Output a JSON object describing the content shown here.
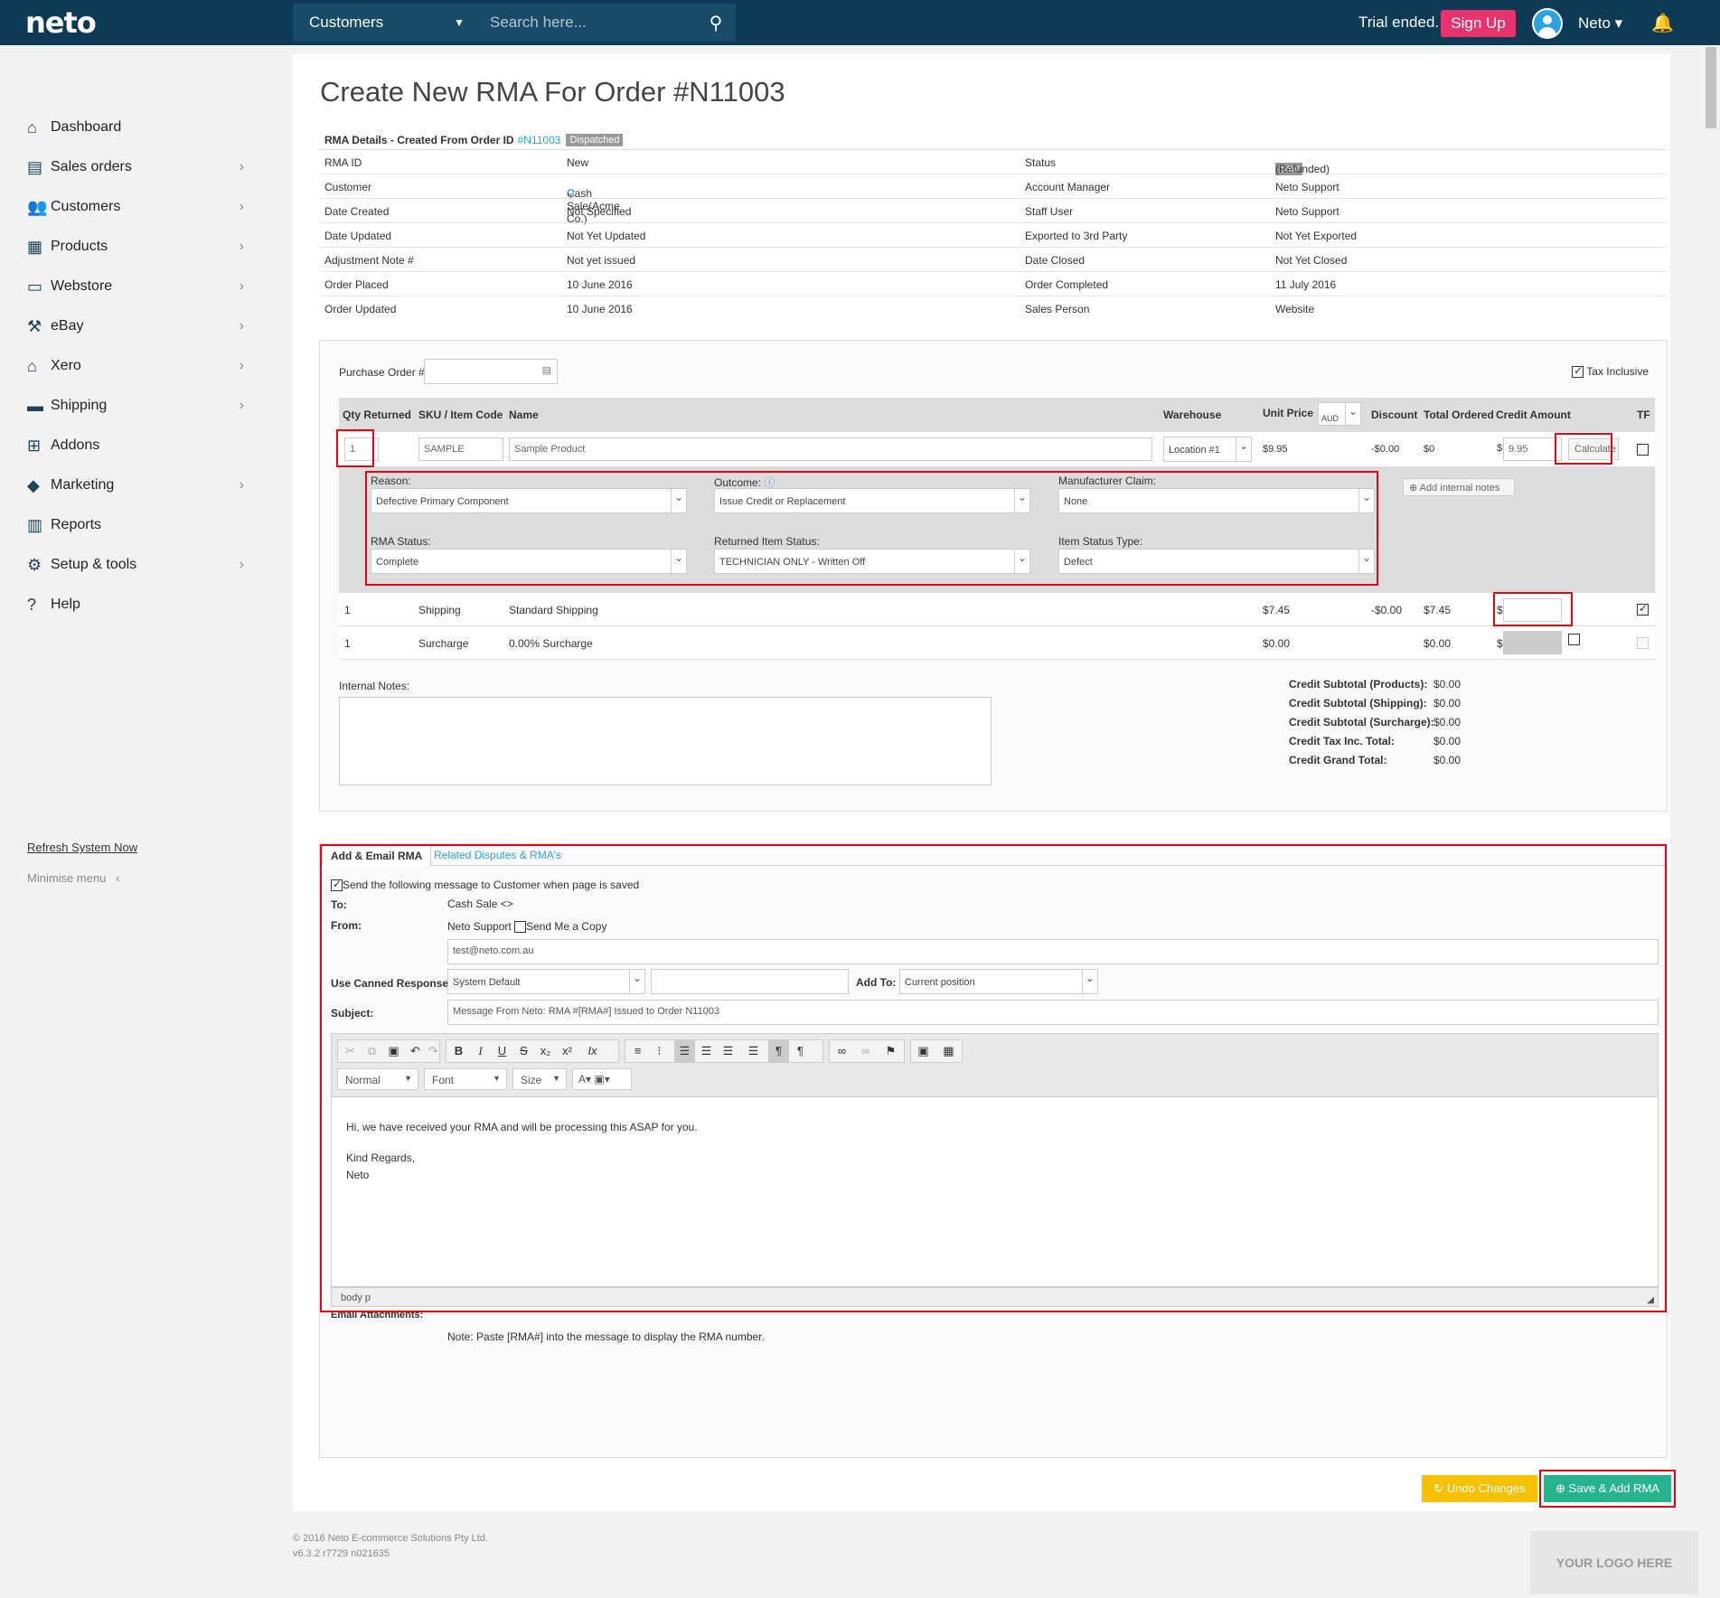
{
  "header": {
    "logo": "neto",
    "search_scope": "Customers",
    "search_placeholder": "Search here...",
    "trial": "Trial ended.",
    "signup": "Sign Up",
    "user": "Neto ▾"
  },
  "sidebar": {
    "items": [
      {
        "label": "Dashboard",
        "icon": "home-icon",
        "glyph": "⌂"
      },
      {
        "label": "Sales orders",
        "icon": "document-icon",
        "glyph": "▤"
      },
      {
        "label": "Customers",
        "icon": "users-icon",
        "glyph": "👥"
      },
      {
        "label": "Products",
        "icon": "box-icon",
        "glyph": "▦"
      },
      {
        "label": "Webstore",
        "icon": "window-icon",
        "glyph": "▭"
      },
      {
        "label": "eBay",
        "icon": "gavel-icon",
        "glyph": "⚒"
      },
      {
        "label": "Xero",
        "icon": "bank-icon",
        "glyph": "⌂"
      },
      {
        "label": "Shipping",
        "icon": "truck-icon",
        "glyph": "▬"
      },
      {
        "label": "Addons",
        "icon": "plus-icon",
        "glyph": "⊞"
      },
      {
        "label": "Marketing",
        "icon": "tag-icon",
        "glyph": "◆"
      },
      {
        "label": "Reports",
        "icon": "bar-chart-icon",
        "glyph": "▥"
      },
      {
        "label": "Setup & tools",
        "icon": "gear-icon",
        "glyph": "⚙"
      },
      {
        "label": "Help",
        "icon": "question-icon",
        "glyph": "?"
      }
    ],
    "refresh": "Refresh System Now",
    "minimise": "Minimise menu"
  },
  "page": {
    "title": "Create New RMA For Order #N11003"
  },
  "details": {
    "head": "RMA Details - Created From Order ID",
    "order_link": "#N11003",
    "dispatched": "Dispatched",
    "rows": [
      {
        "l1": "RMA ID",
        "v1": "New",
        "l2": "Status",
        "v2": "(Refunded)",
        "badge": "New"
      },
      {
        "l1": "Customer",
        "v1": "Cash Sale(Acme Co.)",
        "l2": "Account Manager",
        "v2": "Neto Support"
      },
      {
        "l1": "Date Created",
        "v1": "Not Specified",
        "l2": "Staff User",
        "v2": "Neto Support"
      },
      {
        "l1": "Date Updated",
        "v1": "Not Yet Updated",
        "l2": "Exported to 3rd Party",
        "v2": "Not Yet Exported"
      },
      {
        "l1": "Adjustment Note #",
        "v1": "Not yet issued",
        "l2": "Date Closed",
        "v2": "Not Yet Closed"
      },
      {
        "l1": "Order Placed",
        "v1": "10 June 2016",
        "l2": "Order Completed",
        "v2": "11 July 2016"
      },
      {
        "l1": "Order Updated",
        "v1": "10 June 2016",
        "l2": "Sales Person",
        "v2": "Website"
      }
    ]
  },
  "items": {
    "po_label": "Purchase Order #",
    "tax_inclusive": "Tax Inclusive",
    "headers": {
      "qty": "Qty Returned",
      "sku": "SKU / Item Code",
      "name": "Name",
      "warehouse": "Warehouse",
      "unit_price": "Unit Price",
      "currency": "AUD",
      "discount": "Discount",
      "total_ordered": "Total Ordered",
      "credit": "Credit Amount",
      "tf": "TF"
    },
    "product": {
      "qty": "1",
      "sku": "SAMPLE",
      "name": "Sample Product",
      "warehouse": "Location #1",
      "unit_price": "$9.95",
      "discount": "-$0.00",
      "total": "$0",
      "dollar": "$",
      "credit": "9.95",
      "calculate": "Calculate"
    },
    "detail": {
      "reason_l": "Reason:",
      "reason": "Defective Primary Component",
      "outcome_l": "Outcome:",
      "outcome": "Issue Credit or Replacement",
      "mfr_l": "Manufacturer Claim:",
      "mfr": "None",
      "rma_status_l": "RMA Status:",
      "rma_status": "Complete",
      "ret_status_l": "Returned Item Status:",
      "ret_status": "TECHNICIAN ONLY - Written Off",
      "item_type_l": "Item Status Type:",
      "item_type": "Defect",
      "add_notes": "Add internal notes"
    },
    "shipping": {
      "qty": "1",
      "sku": "Shipping",
      "name": "Standard Shipping",
      "unit_price": "$7.45",
      "discount": "-$0.00",
      "total": "$7.45",
      "dollar": "$"
    },
    "surcharge": {
      "qty": "1",
      "sku": "Surcharge",
      "name": "0.00% Surcharge",
      "unit_price": "$0.00",
      "total": "$0.00",
      "dollar": "$"
    },
    "notes_label": "Internal Notes:",
    "totals": [
      {
        "l": "Credit Subtotal (Products):",
        "v": "$0.00"
      },
      {
        "l": "Credit Subtotal (Shipping):",
        "v": "$0.00"
      },
      {
        "l": "Credit Subtotal (Surcharge):",
        "v": "$0.00"
      },
      {
        "l": "Credit Tax Inc. Total:",
        "v": "$0.00"
      },
      {
        "l": "Credit Grand Total:",
        "v": "$0.00"
      }
    ]
  },
  "email": {
    "tab1": "Add & Email RMA",
    "tab2": "Related Disputes & RMA's",
    "send_msg": "Send the following message to Customer when page is saved",
    "to_l": "To:",
    "to": "Cash Sale  <>",
    "from_l": "From:",
    "from": "Neto Support",
    "send_copy": "Send Me a Copy",
    "from_email": "test@neto.com.au",
    "canned_l": "Use Canned Response:",
    "canned": "System Default",
    "add_to_l": "Add To:",
    "add_to": "Current position",
    "subject_l": "Subject:",
    "subject": "Message From Neto: RMA #[RMA#] Issued to Order N11003",
    "format": "Normal",
    "font": "Font",
    "size": "Size",
    "body1": "Hi, we have received your RMA and will be processing this ASAP for you.",
    "body2": "Kind Regards,",
    "body3": "Neto",
    "path": "body   p",
    "attachments": "Email Attachments:",
    "note": "Note: Paste [RMA#] into the message to display the RMA number."
  },
  "actions": {
    "undo": "Undo Changes",
    "save": "Save & Add RMA"
  },
  "footer": {
    "copy": "© 2016 Neto E-commerce Solutions Pty Ltd.",
    "version": "v6.3.2 r7729 n021635",
    "your_logo": "YOUR LOGO HERE"
  }
}
